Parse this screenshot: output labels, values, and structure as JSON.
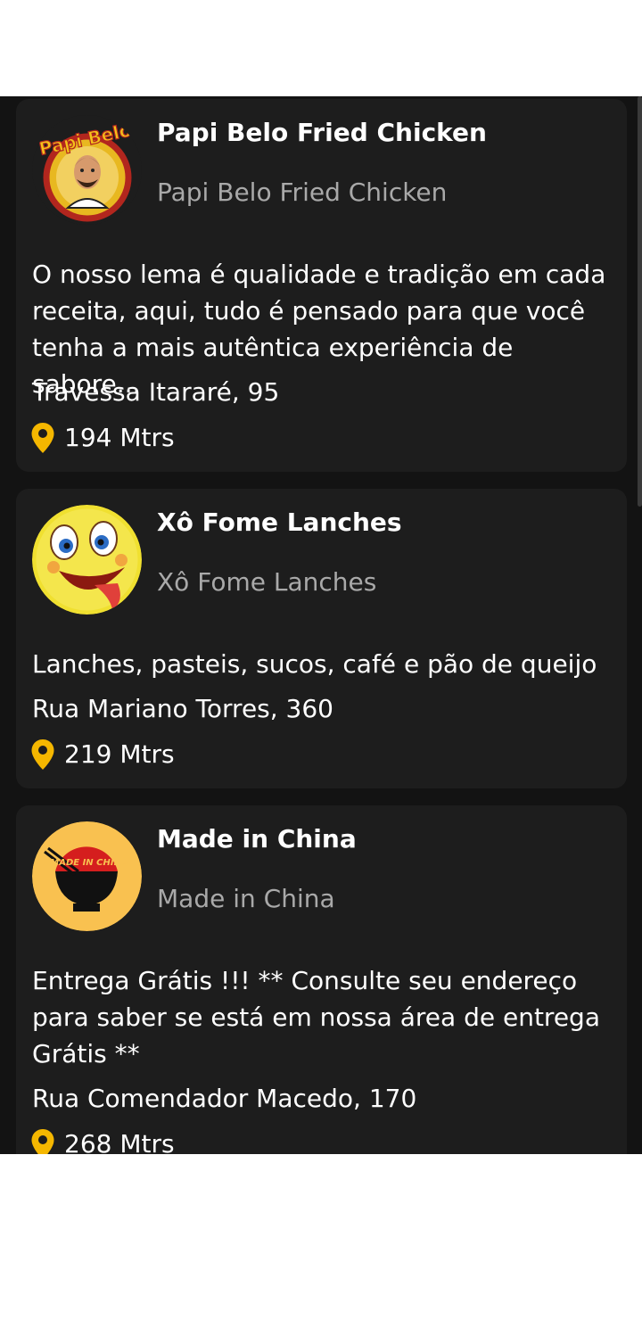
{
  "restaurants": [
    {
      "name": "Papi Belo Fried Chicken",
      "subname": "Papi Belo Fried Chicken",
      "description": "O nosso lema é qualidade e tradição em cada receita, aqui, tudo é pensado para que você tenha a mais autêntica experiência de sabore...",
      "address": "Travessa Itararé, 95",
      "distance": "194 Mtrs",
      "logo_text": "Papi Belo"
    },
    {
      "name": "Xô Fome Lanches",
      "subname": "Xô Fome Lanches",
      "description": "Lanches, pasteis, sucos, café e pão de queijo",
      "address": "Rua Mariano Torres, 360",
      "distance": "219 Mtrs"
    },
    {
      "name": "Made in China",
      "subname": "Made in China",
      "description": "Entrega Grátis !!!  ** Consulte seu endereço para saber se está em nossa área de entrega Grátis **",
      "address": "Rua Comendador Macedo, 170",
      "distance": "268 Mtrs",
      "logo_text": "MADE IN CHINA"
    }
  ],
  "colors": {
    "background": "#131313",
    "card": "#1d1d1d",
    "accent": "#f5b700",
    "subtext": "#a9a9a9"
  },
  "icons": {
    "distance": "location-pin-icon"
  }
}
